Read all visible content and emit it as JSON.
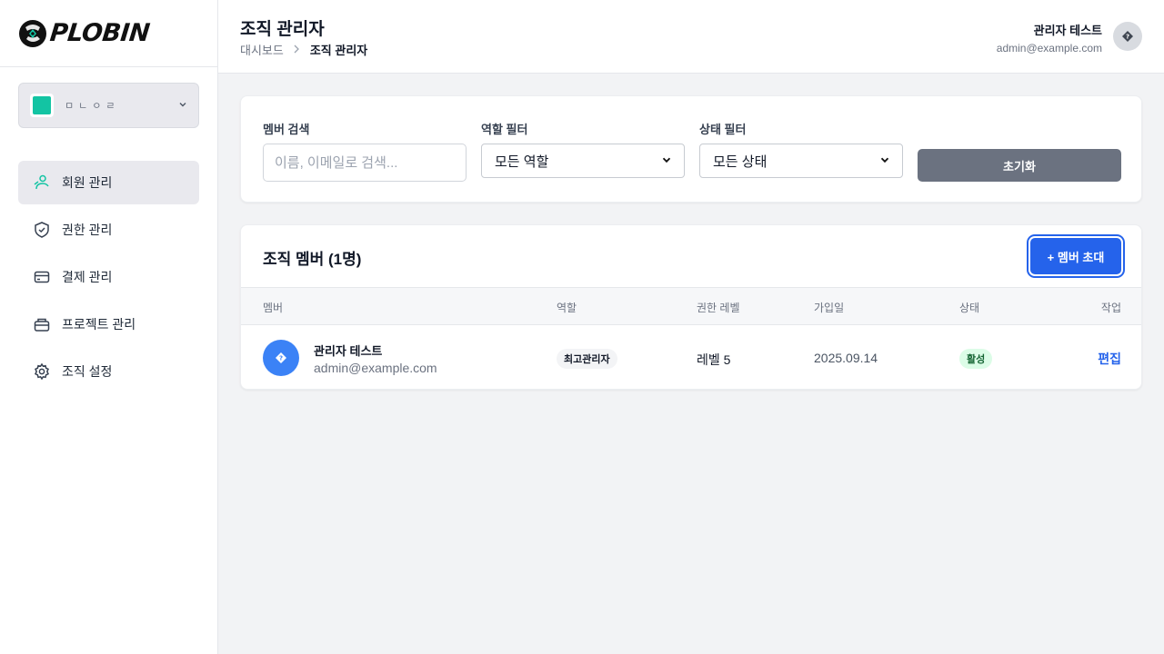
{
  "brand": {
    "name": "PLOBIN",
    "accent": "#13c4a3",
    "primary": "#2563eb"
  },
  "org": {
    "name": "ㅁㄴㅇㄹ"
  },
  "sidebar": {
    "items": [
      {
        "label": "회원 관리",
        "icon": "users-icon"
      },
      {
        "label": "권한 관리",
        "icon": "shield-icon"
      },
      {
        "label": "결제 관리",
        "icon": "credit-card-icon"
      },
      {
        "label": "프로젝트 관리",
        "icon": "briefcase-icon"
      },
      {
        "label": "조직 설정",
        "icon": "gear-icon"
      }
    ]
  },
  "header": {
    "title": "조직 관리자",
    "breadcrumb": {
      "parent": "대시보드",
      "current": "조직 관리자"
    },
    "user": {
      "name": "관리자 테스트",
      "email": "admin@example.com"
    }
  },
  "filters": {
    "search": {
      "label": "멤버 검색",
      "placeholder": "이름, 이메일로 검색..."
    },
    "role": {
      "label": "역할 필터",
      "selected": "모든 역할"
    },
    "status": {
      "label": "상태 필터",
      "selected": "모든 상태"
    },
    "reset_label": "초기화"
  },
  "members": {
    "title": "조직 멤버 (1명)",
    "invite_label": "+ 멤버 초대",
    "columns": [
      "멤버",
      "역할",
      "권한 레벨",
      "가입일",
      "상태",
      "작업"
    ],
    "rows": [
      {
        "name": "관리자 테스트",
        "email": "admin@example.com",
        "role": "최고관리자",
        "level": "레벨 5",
        "joined": "2025.09.14",
        "status": "활성",
        "action": "편집"
      }
    ]
  }
}
